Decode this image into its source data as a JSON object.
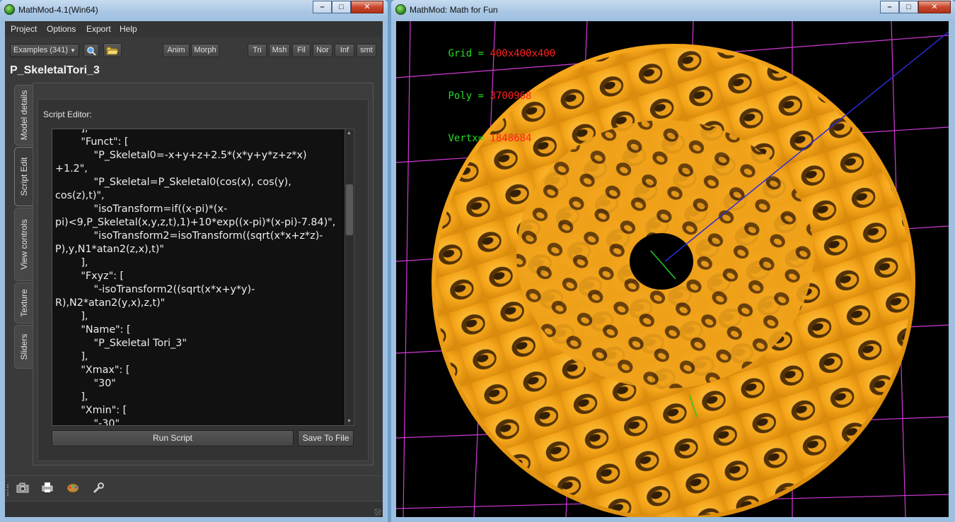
{
  "left_window": {
    "title": "MathMod-4.1(Win64)",
    "controls": {
      "minimize": "–",
      "maximize": "□",
      "close": "✕"
    }
  },
  "menu": {
    "items": [
      "Project",
      "Options",
      "Export",
      "Help"
    ]
  },
  "toolbar": {
    "examples_combo": "Examples (341)",
    "search_icon": "search-icon",
    "open_icon": "folder-open-icon",
    "anim_label": "Anim",
    "morph_label": "Morph",
    "view_buttons": [
      "Tri",
      "Msh",
      "Fil",
      "Nor",
      "Inf",
      "smt"
    ]
  },
  "model_name": "P_SkeletalTori_3",
  "side_tabs": [
    "Model details",
    "Script Edit",
    "View controls",
    "Texture",
    "Sliders"
  ],
  "active_tab": "Script Edit",
  "editor": {
    "label": "Script Editor:",
    "content": "        ],\n        \"Funct\": [\n            \"P_Skeletal0=-x+y+z+2.5*(x*y+y*z+z*x)\n+1.2\",\n            \"P_Skeletal=P_Skeletal0(cos(x), cos(y),\ncos(z),t)\",\n            \"isoTransform=if((x-pi)*(x-\npi)<9,P_Skeletal(x,y,z,t),1)+10*exp((x-pi)*(x-pi)-7.84)\",\n            \"isoTransform2=isoTransform((sqrt(x*x+z*z)-\nP),y,N1*atan2(z,x),t)\"\n        ],\n        \"Fxyz\": [\n            \"-isoTransform2((sqrt(x*x+y*y)-\nR),N2*atan2(y,x),z,t)\"\n        ],\n        \"Name\": [\n            \"P_Skeletal Tori_3\"\n        ],\n        \"Xmax\": [\n            \"30\"\n        ],\n        \"Xmin\": [\n            \"-30\"",
    "run_label": "Run Script",
    "save_label": "Save To File"
  },
  "bottom_tools": [
    "camera-icon",
    "print-icon",
    "palette-icon",
    "wrench-icon"
  ],
  "right_window": {
    "title": "MathMod: Math for Fun",
    "controls": {
      "minimize": "–",
      "maximize": "□",
      "close": "✕"
    }
  },
  "stats": [
    {
      "key": "Grid = ",
      "value": "400x400x400"
    },
    {
      "key": "Poly = ",
      "value": "3700968"
    },
    {
      "key": "Vertx= ",
      "value": "1848684"
    }
  ],
  "colors": {
    "surface": "#f5a61a",
    "grid_lines": "#d13ad6",
    "axis": "#2a2ad6",
    "stats_key": "#22dd22",
    "stats_value": "#ff2222"
  }
}
